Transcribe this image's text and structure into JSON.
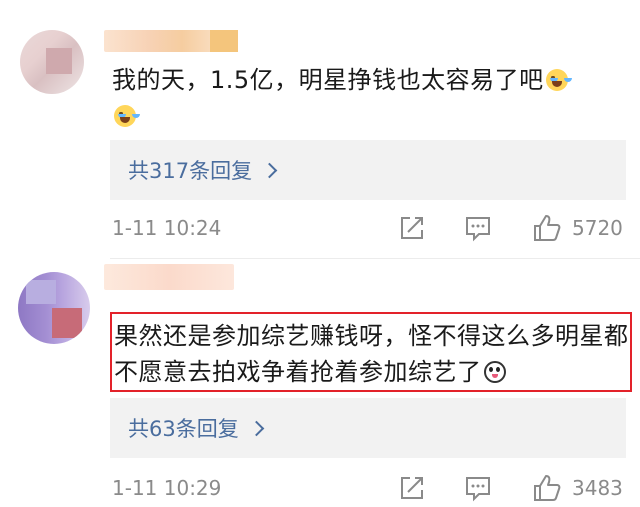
{
  "comments": [
    {
      "text": "我的天，1.5亿，明星挣钱也太容易了吧",
      "emojis": [
        "loudly-crying-emoji",
        "loudly-crying-emoji"
      ],
      "replies_label": "共317条回复",
      "time": "1-11 10:24",
      "likes": "5720"
    },
    {
      "text": "果然还是参加综艺赚钱呀，怪不得这么多明星都不愿意去拍戏争着抢着参加综艺了",
      "emojis": [
        "panda-emoji"
      ],
      "replies_label": "共63条回复",
      "time": "1-11 10:29",
      "likes": "3483",
      "highlight_color": "#e3222a"
    }
  ],
  "colors": {
    "link": "#4a6d9e",
    "meta": "#8a8a8a",
    "reply_bg": "#f2f2f2"
  },
  "icons": [
    "share-icon",
    "comment-icon",
    "like-icon",
    "chevron-right-icon"
  ]
}
